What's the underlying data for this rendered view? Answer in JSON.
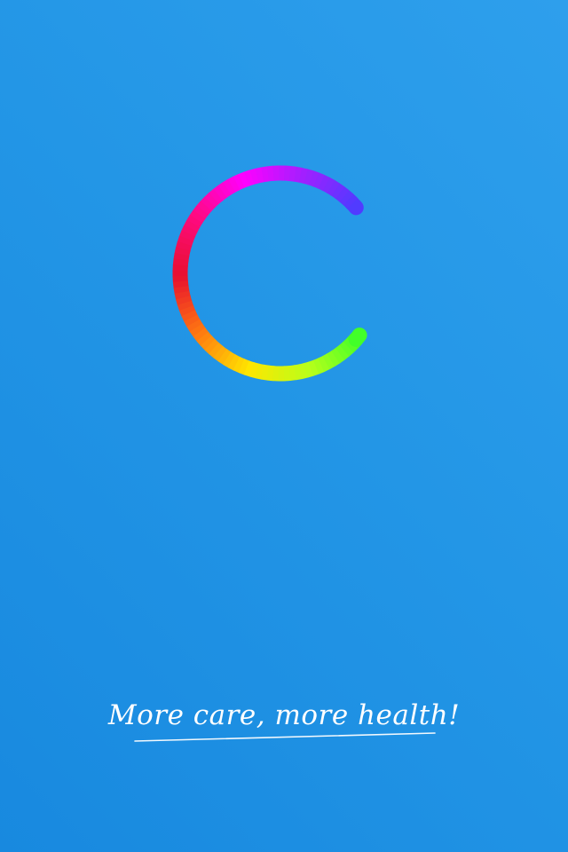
{
  "splash": {
    "tagline": "More care, more health!",
    "logo_icon": "rainbow-ring-logo-icon",
    "background_colors": [
      "#1889df",
      "#2e9fec"
    ],
    "ring_colors": [
      "#4d3cff",
      "#a020ff",
      "#ff00ff",
      "#ff0a80",
      "#e8102e",
      "#ff7a10",
      "#ffe600",
      "#b8ff1a",
      "#3cff2a"
    ]
  }
}
